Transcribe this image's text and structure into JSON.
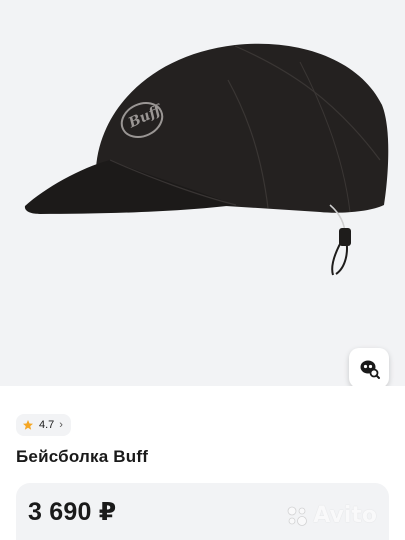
{
  "product": {
    "rating": "4.7",
    "title": "Бейсболка Buff",
    "price": "3 690 ₽",
    "brand_logo_text": "Buff"
  },
  "watermark": {
    "text": "Avito"
  },
  "icons": {
    "lens": "search-by-image-icon",
    "star": "star-icon",
    "chevron": "chevron-right-icon"
  },
  "colors": {
    "star": "#f5a623",
    "background": "#f2f3f5",
    "text": "#1a1a1a"
  }
}
